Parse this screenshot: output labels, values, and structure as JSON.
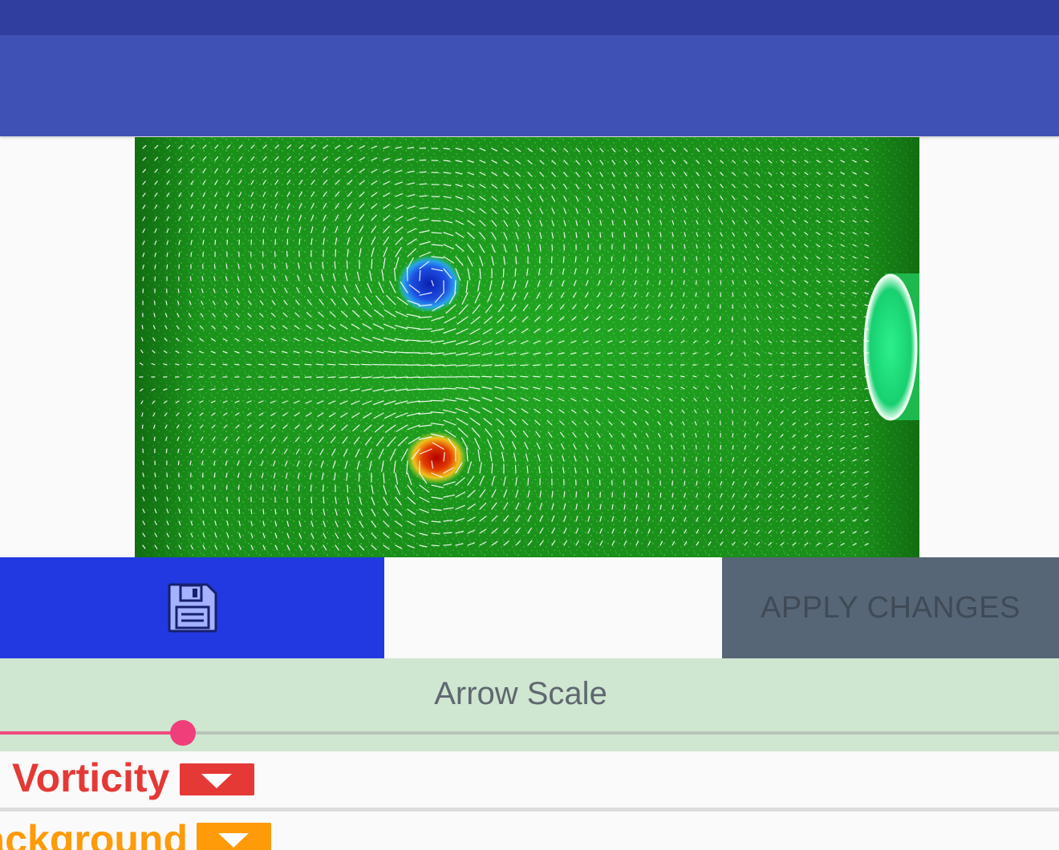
{
  "toolbar": {
    "save_icon": "save-icon",
    "apply_label": "APPLY CHANGES"
  },
  "arrow_scale": {
    "title": "Arrow Scale",
    "value_fraction": 0.173
  },
  "layers": {
    "vorticity_label": "Vorticity",
    "background_label": "Background"
  },
  "colors": {
    "status_bar": "#303f9f",
    "app_bar": "#3f51b5",
    "save_button": "#2238e0",
    "apply_button": "#566676",
    "slider_accent": "#f03e7a",
    "vorticity": "#e53935",
    "background": "#ff9a08"
  }
}
